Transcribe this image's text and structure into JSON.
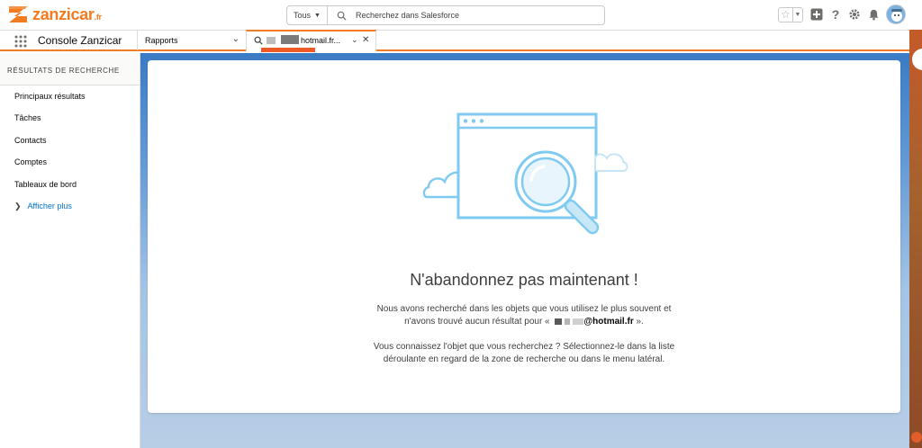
{
  "brand": {
    "logo_text": "zanzicar",
    "logo_suffix": ".fr",
    "accent": "#f47b20"
  },
  "search": {
    "scope": "Tous",
    "placeholder": "Recherchez dans Salesforce"
  },
  "header_icons": [
    "star-icon",
    "add-icon",
    "help-icon",
    "setup-gear-icon",
    "notification-bell-icon",
    "avatar"
  ],
  "nav": {
    "app_name": "Console Zanzicar",
    "items": [
      {
        "label": "Rapports"
      }
    ],
    "active_tab": {
      "label": "hotmail.fr..."
    }
  },
  "sidebar": {
    "heading": "RÉSULTATS DE RECHERCHE",
    "items": [
      {
        "label": "Principaux résultats"
      },
      {
        "label": "Tâches"
      },
      {
        "label": "Contacts"
      },
      {
        "label": "Comptes"
      },
      {
        "label": "Tableaux de bord"
      }
    ],
    "more_label": "Afficher plus"
  },
  "empty_state": {
    "title": "N'abandonnez pas maintenant !",
    "line1": "Nous avons recherché dans les objets que vous utilisez le plus souvent et",
    "line2_prefix": "n'avons trouvé aucun résultat pour «",
    "line2_term": "@hotmail.fr",
    "line2_suffix": "».",
    "line3": "Vous connaissez l'objet que vous recherchez ? Sélectionnez-le dans la liste",
    "line4": "déroulante en regard de la zone de recherche ou dans le menu latéral."
  }
}
